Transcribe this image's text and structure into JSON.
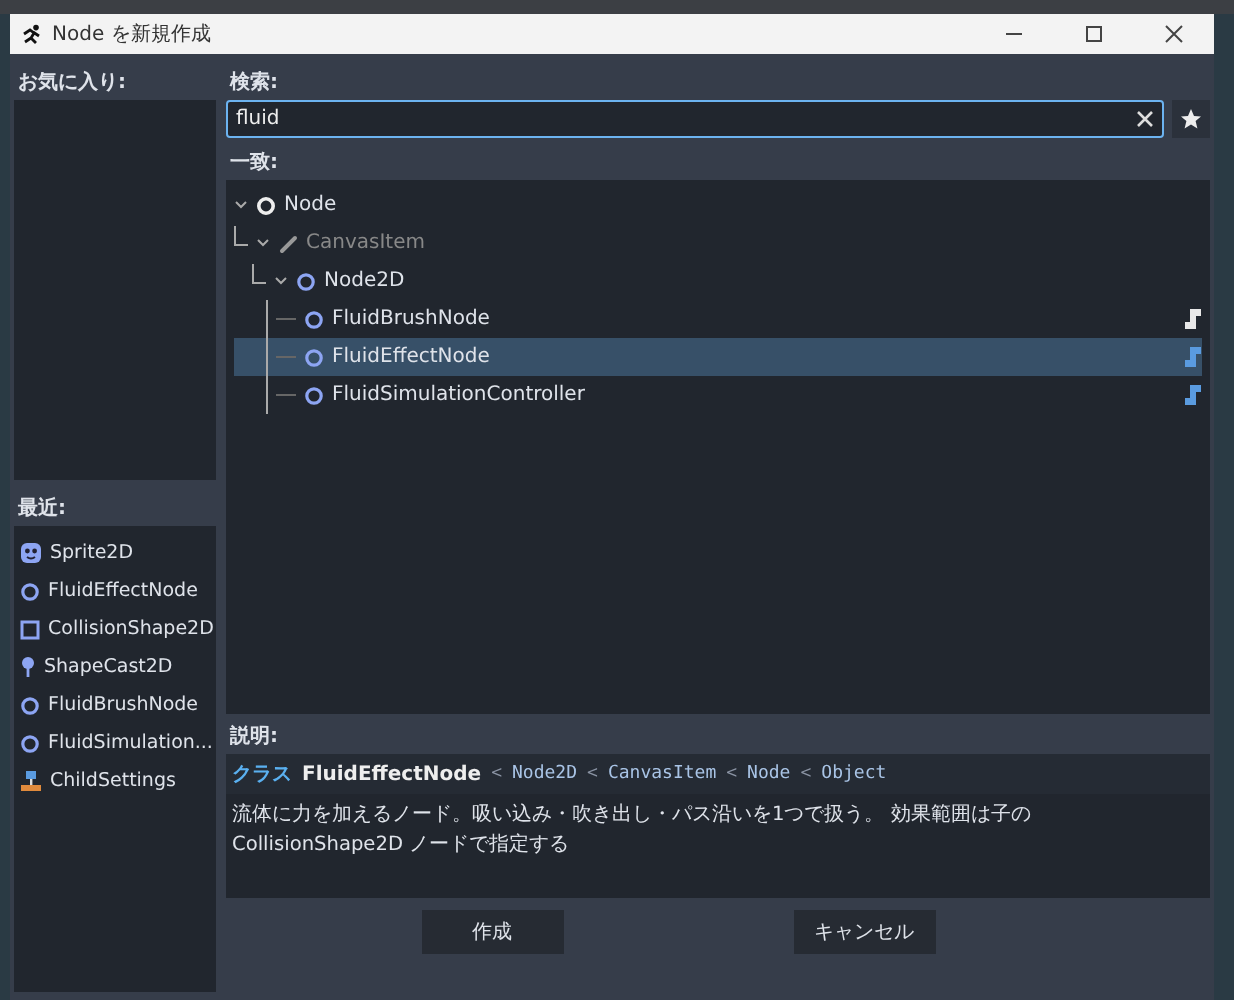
{
  "window": {
    "title": "Node を新規作成"
  },
  "favorites": {
    "label": "お気に入り:"
  },
  "recent": {
    "label": "最近:",
    "items": [
      {
        "label": "Sprite2D",
        "kind": "sprite"
      },
      {
        "label": "FluidEffectNode",
        "kind": "circle"
      },
      {
        "label": "CollisionShape2D",
        "kind": "square"
      },
      {
        "label": "ShapeCast2D",
        "kind": "pin"
      },
      {
        "label": "FluidBrushNode",
        "kind": "circle"
      },
      {
        "label": "FluidSimulation...",
        "kind": "circle"
      },
      {
        "label": "ChildSettings",
        "kind": "settings"
      }
    ]
  },
  "search": {
    "label": "検索:",
    "value": "fluid"
  },
  "matches": {
    "label": "一致:",
    "tree": [
      {
        "label": "Node",
        "kind": "node",
        "disabled": false,
        "selected": false,
        "expanded": true,
        "children": [
          {
            "label": "CanvasItem",
            "kind": "brush",
            "disabled": true,
            "selected": false,
            "expanded": true,
            "children": [
              {
                "label": "Node2D",
                "kind": "circle",
                "disabled": false,
                "selected": false,
                "expanded": true,
                "children": [
                  {
                    "label": "FluidBrushNode",
                    "kind": "circle",
                    "disabled": false,
                    "selected": false,
                    "color": "#e8e8e8"
                  },
                  {
                    "label": "FluidEffectNode",
                    "kind": "circle",
                    "disabled": false,
                    "selected": true,
                    "color": "#5a9be0"
                  },
                  {
                    "label": "FluidSimulationController",
                    "kind": "circle",
                    "disabled": false,
                    "selected": false,
                    "color": "#5a9be0"
                  }
                ]
              }
            ]
          }
        ]
      }
    ]
  },
  "description": {
    "label": "説明:",
    "class_label": "クラス",
    "class_name": "FluidEffectNode",
    "separator": "<",
    "inherits": [
      "Node2D",
      "CanvasItem",
      "Node",
      "Object"
    ],
    "text": "流体に力を加えるノード。吸い込み・吹き出し・パス沿いを1つで扱う。 効果範囲は子の CollisionShape2D ノードで指定する"
  },
  "buttons": [
    {
      "label": "作成"
    },
    {
      "label": "キャンセル"
    }
  ]
}
